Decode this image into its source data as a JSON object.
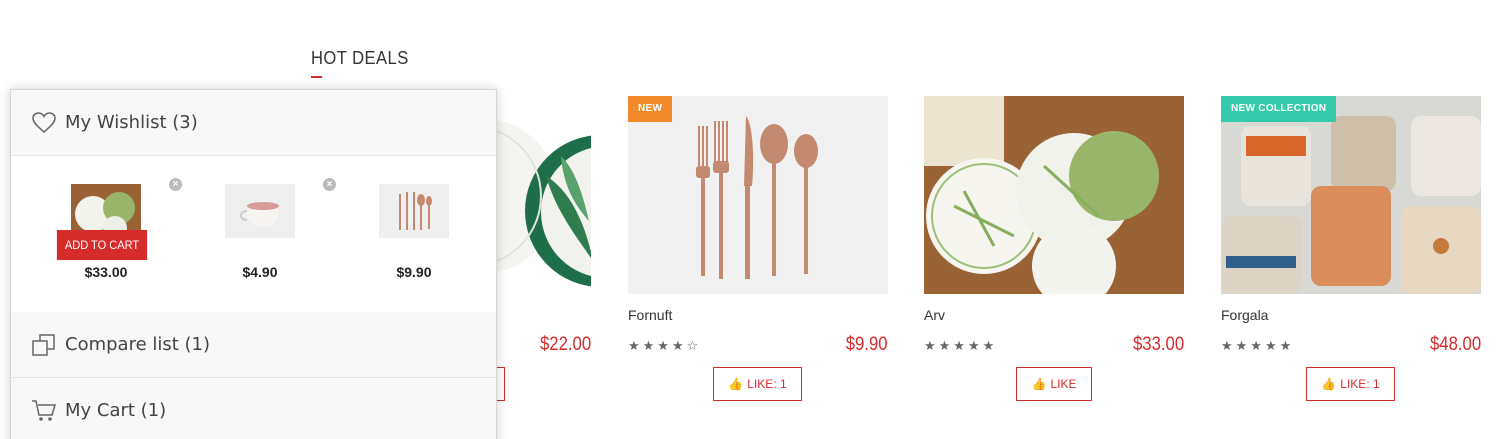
{
  "section": {
    "title": "HOT DEALS"
  },
  "products": [
    {
      "name": "",
      "price": "$22.00",
      "badge": "",
      "rating": 0,
      "like": ""
    },
    {
      "name": "Fornuft",
      "price": "$9.90",
      "badge": "NEW",
      "rating": 4,
      "like": "LIKE: 1"
    },
    {
      "name": "Arv",
      "price": "$33.00",
      "badge": "",
      "rating": 5,
      "like": "LIKE"
    },
    {
      "name": "Forgala",
      "price": "$48.00",
      "badge": "NEW COLLECTION",
      "rating": 5,
      "like": "LIKE: 1"
    }
  ],
  "stars": {
    "fornuft": "★★★★☆",
    "arv": "★★★★★",
    "forgala": "★★★★★"
  },
  "panel": {
    "wishlist_label": "My Wishlist (3)",
    "compare_label": "Compare list (1)",
    "cart_label": "My Cart (1)",
    "add_to_cart": "ADD TO CART",
    "wishlist_items": [
      {
        "price": "$33.00"
      },
      {
        "price": "$4.90"
      },
      {
        "price": "$9.90"
      }
    ]
  },
  "colors": {
    "accent": "#d62b2b",
    "badge_new": "#f28a2c",
    "badge_collection": "#35cbaa"
  },
  "icons": [
    "heart-icon",
    "compare-icon",
    "cart-icon",
    "thumbs-up-icon",
    "remove-icon",
    "star-icon"
  ]
}
